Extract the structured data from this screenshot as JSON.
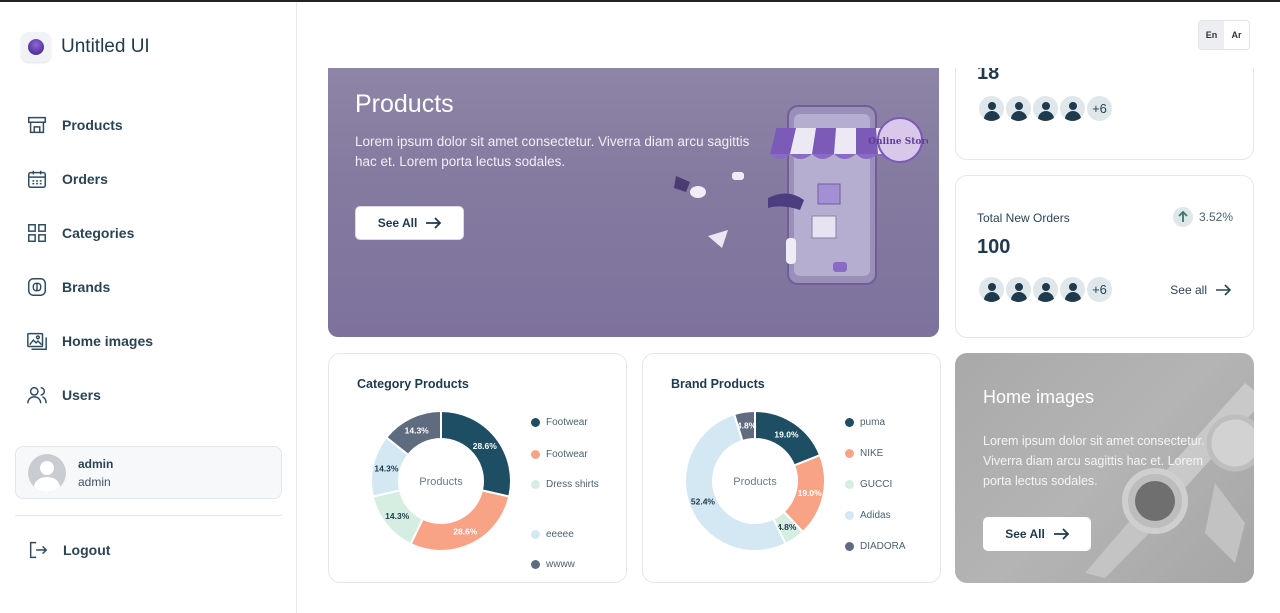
{
  "brand": {
    "name": "Untitled UI"
  },
  "nav": [
    {
      "label": "Products",
      "icon": "store-icon"
    },
    {
      "label": "Orders",
      "icon": "calendar-icon"
    },
    {
      "label": "Categories",
      "icon": "grid-icon"
    },
    {
      "label": "Brands",
      "icon": "brand-icon"
    },
    {
      "label": "Home images",
      "icon": "images-icon"
    },
    {
      "label": "Users",
      "icon": "users-icon"
    }
  ],
  "user": {
    "name": "admin",
    "role": "admin"
  },
  "logout": {
    "label": "Logout"
  },
  "lang": {
    "en": "En",
    "ar": "Ar"
  },
  "hero": {
    "title": "Products",
    "text": "Lorem ipsum dolor sit amet consectetur. Viverra diam arcu sagittis hac et. Lorem porta lectus sodales.",
    "button": "See All",
    "badge": "Online Store"
  },
  "stat_top": {
    "value": "18",
    "more": "+6"
  },
  "stat_orders": {
    "label": "Total New Orders",
    "change": "3.52%",
    "value": "100",
    "more": "+6",
    "link": "See all"
  },
  "category_chart": {
    "title": "Category Products",
    "center": "Products",
    "legend": [
      "Footwear",
      "Footwear",
      "Dress shirts",
      "eeeee",
      "wwww"
    ]
  },
  "brand_chart": {
    "title": "Brand Products",
    "center": "Products",
    "legend": [
      "puma",
      "NIKE",
      "GUCCI",
      "Adidas",
      "DIADORA"
    ]
  },
  "home_images": {
    "title": "Home images",
    "text": "Lorem ipsum dolor sit amet consectetur. Viverra diam arcu sagittis hac et. Lorem porta lectus sodales.",
    "button": "See All"
  },
  "chart_data": [
    {
      "type": "pie",
      "title": "Category Products",
      "center_label": "Products",
      "categories": [
        "Footwear",
        "Footwear",
        "Dress shirts",
        "eeeee",
        "wwww"
      ],
      "values": [
        28.6,
        28.6,
        14.3,
        14.3,
        14.3
      ],
      "labels": [
        "28.6%",
        "28.6%",
        "14.3%",
        "14.3%",
        "14.3%"
      ],
      "colors": [
        "#1e4e63",
        "#f9a386",
        "#d6eee2",
        "#d3e8f2",
        "#5f6b7e"
      ],
      "legend": "right"
    },
    {
      "type": "pie",
      "title": "Brand Products",
      "center_label": "Products",
      "categories": [
        "puma",
        "NIKE",
        "GUCCI",
        "Adidas",
        "DIADORA"
      ],
      "values": [
        19.0,
        19.0,
        4.8,
        52.4,
        4.8
      ],
      "labels": [
        "19.0%",
        "19.0%",
        "4.8%",
        "52.4%",
        "4.8%"
      ],
      "colors": [
        "#1e4e63",
        "#f9a386",
        "#d6eee2",
        "#d3e8f2",
        "#5f6b7e"
      ],
      "legend": "right"
    }
  ]
}
